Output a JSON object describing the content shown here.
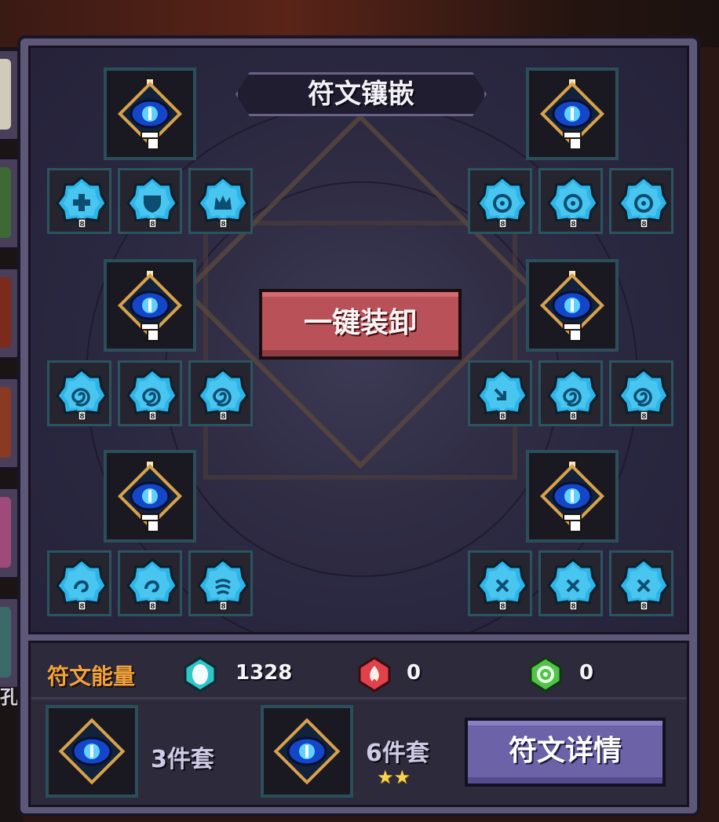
{
  "title": "符文镶嵌",
  "unequip_all_label": "一键装卸",
  "energy": {
    "label": "符文能量",
    "items": [
      {
        "icon": "white-crystal-icon",
        "value": "1328",
        "color": "#7fe7ee"
      },
      {
        "icon": "red-flame-gem-icon",
        "value": "0",
        "color": "#e0414a"
      },
      {
        "icon": "green-swirl-gem-icon",
        "value": "0",
        "color": "#52c24a"
      }
    ]
  },
  "sets": [
    {
      "label": "3件套",
      "stars": ""
    },
    {
      "label": "6件套",
      "stars": "★★"
    }
  ],
  "detail_button_label": "符文详情",
  "side_label": "孔",
  "rune_groups": [
    {
      "key_icon": "key-eye-amulet-icon",
      "runes": [
        "cross-rune-icon",
        "shield-rune-icon",
        "crown-rune-icon"
      ]
    },
    {
      "key_icon": "key-eye-amulet-icon",
      "runes": [
        "circle-rune-icon",
        "circle-rune-icon",
        "circle-rune-icon"
      ]
    },
    {
      "key_icon": "key-eye-amulet-icon",
      "runes": [
        "spiral-rune-icon",
        "spiral-rune-icon",
        "spiral-rune-icon"
      ]
    },
    {
      "key_icon": "key-eye-amulet-icon",
      "runes": [
        "arrow-rune-icon",
        "spiral-rune-icon",
        "spiral-rune-icon"
      ]
    },
    {
      "key_icon": "key-eye-amulet-icon",
      "runes": [
        "swirl-rune-icon",
        "swirl-rune-icon",
        "claw-rune-icon"
      ]
    },
    {
      "key_icon": "key-eye-amulet-icon",
      "runes": [
        "x-rune-icon",
        "x-rune-icon",
        "x-rune-icon"
      ]
    }
  ],
  "rune_level_mark": "8",
  "colors": {
    "rune_blue": "#2fb4e8",
    "gold": "#d7a24a",
    "panel": "#5d5878",
    "unequip_red": "#b85258",
    "detail_purple": "#6b62a8"
  }
}
